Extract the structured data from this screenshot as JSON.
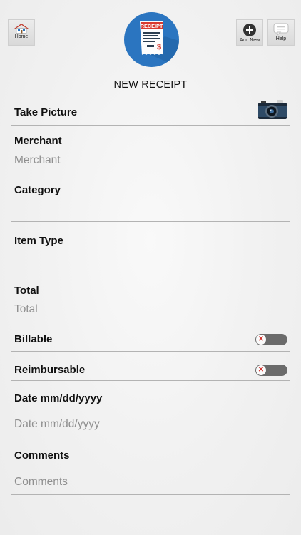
{
  "header": {
    "home_label": "Home",
    "add_new_label": "Add New",
    "help_label": "Help",
    "logo_receipt_text": "RECEIPT",
    "logo_currency_symbol": "$",
    "title": "NEW RECEIPT"
  },
  "form": {
    "take_picture_label": "Take Picture",
    "merchant_label": "Merchant",
    "merchant_placeholder": "Merchant",
    "category_label": "Category",
    "item_type_label": "Item Type",
    "total_label": "Total",
    "total_placeholder": "Total",
    "billable_label": "Billable",
    "billable_on": false,
    "reimbursable_label": "Reimbursable",
    "reimbursable_on": false,
    "date_label": "Date mm/dd/yyyy",
    "date_placeholder": "Date mm/dd/yyyy",
    "comments_label": "Comments",
    "comments_placeholder": "Comments"
  },
  "colors": {
    "logo_blue": "#2b75c0",
    "toggle_off": "#6b6b6b",
    "toggle_x": "#d2322d",
    "divider": "#b3b3b3"
  }
}
